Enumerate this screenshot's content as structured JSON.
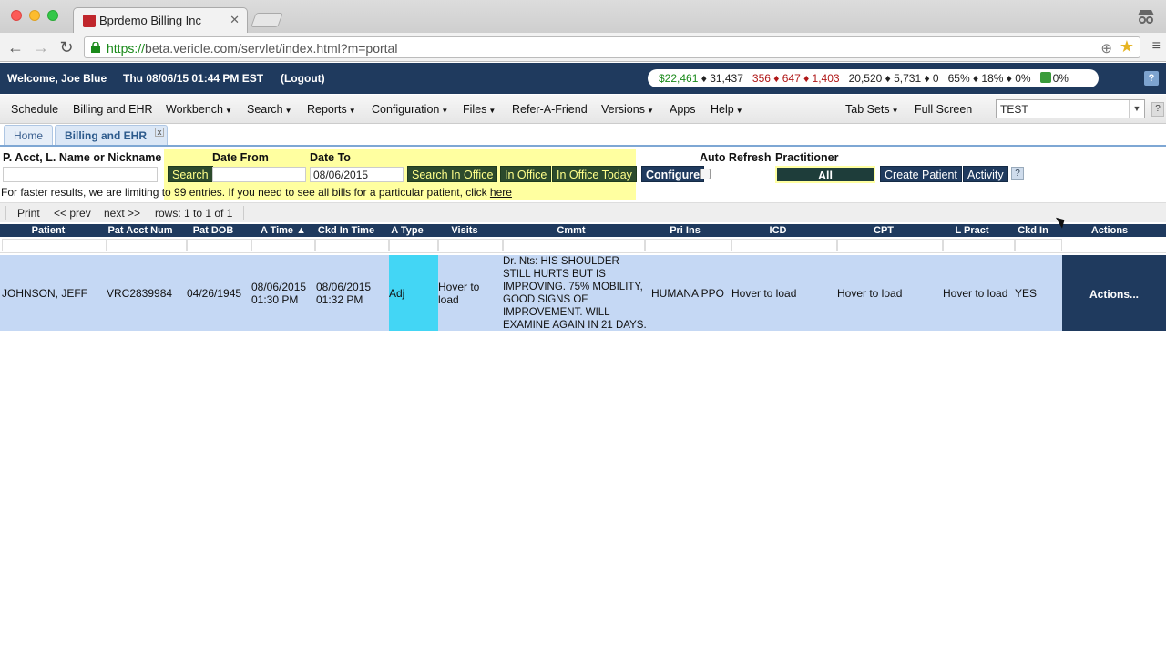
{
  "browser": {
    "tab_title": "Bprdemo Billing Inc",
    "tab_close": "✕",
    "url_https": "https://",
    "url_rest": "beta.vericle.com/servlet/index.html?m=portal"
  },
  "header": {
    "welcome": "Welcome, Joe Blue",
    "datetime": "Thu 08/06/15 01:44 PM EST",
    "logout": "(Logout)",
    "stats": {
      "s1": "$22,461",
      "s2": "♦ 31,437",
      "s3": "356 ♦ 647 ♦ 1,403",
      "s4": "20,520 ♦ 5,731 ♦ 0",
      "s5": "65% ♦ 18% ♦ 0%",
      "s6": "0%"
    },
    "help": "?"
  },
  "menu": {
    "items": [
      "Schedule",
      "Billing and EHR",
      "Workbench",
      "Search",
      "Reports",
      "Configuration",
      "Files",
      "Refer-A-Friend",
      "Versions",
      "Apps",
      "Help",
      "Tab Sets",
      "Full Screen"
    ],
    "selector_value": "TEST",
    "help": "?"
  },
  "tabs": {
    "home": "Home",
    "billing": "Billing and EHR",
    "close": "x"
  },
  "form": {
    "label_patient": "P. Acct, L. Name or Nickname",
    "label_date_from": "Date From",
    "label_date_to": "Date To",
    "label_auto_refresh": "Auto Refresh",
    "label_practitioner": "Practitioner",
    "date_to_value": "08/06/2015",
    "btn_search": "Search",
    "btn_search_in_office": "Search In Office",
    "btn_in_office": "In Office",
    "btn_in_office_today": "In Office Today",
    "btn_configure": "Configure",
    "practitioner_value": "All",
    "btn_create_patient": "Create Patient",
    "btn_activity": "Activity",
    "help": "?",
    "note": "For faster results, we are limiting to 99 entries. If you need to see all bills for a particular patient, click",
    "note_link": "here"
  },
  "pager": {
    "print": "Print",
    "prev": "<< prev",
    "next": "next >>",
    "rows": "rows: 1 to 1 of 1"
  },
  "table": {
    "headers": [
      "Patient",
      "Pat Acct Num",
      "Pat DOB",
      "A Time ▲",
      "Ckd In Time",
      "A Type",
      "Visits",
      "Cmmt",
      "Pri Ins",
      "ICD",
      "CPT",
      "L Pract",
      "Ckd In",
      "Actions"
    ],
    "row": {
      "patient": "JOHNSON, JEFF",
      "acct": "VRC2839984",
      "dob": "04/26/1945",
      "atime1": "08/06/2015",
      "atime2": "01:30 PM",
      "ckd1": "08/06/2015",
      "ckd2": "01:32 PM",
      "atype": "Adj",
      "visits1": "Hover to",
      "visits2": "load",
      "cmmt1": "Dr. Nts: HIS SHOULDER",
      "cmmt2": "STILL HURTS BUT IS",
      "cmmt3": "IMPROVING. 75% MOBILITY,",
      "cmmt4": "GOOD SIGNS OF",
      "cmmt5": "IMPROVEMENT. WILL",
      "cmmt6": "EXAMINE AGAIN IN 21 DAYS.",
      "ins": "HUMANA PPO",
      "icd": "Hover to load",
      "cpt": "Hover to load",
      "lpract": "Hover to load",
      "ckdin": "YES",
      "actions": "Actions..."
    }
  },
  "colors": {
    "navy": "#1f3a5e",
    "highlight_yellow": "#ffffa0",
    "row_blue": "#c5d8f4",
    "atype_cyan": "#43d6f5"
  }
}
